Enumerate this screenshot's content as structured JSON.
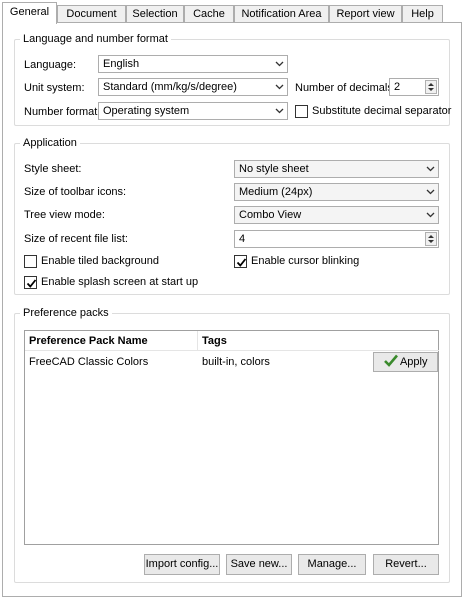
{
  "tabs": [
    {
      "label": "General"
    },
    {
      "label": "Document"
    },
    {
      "label": "Selection"
    },
    {
      "label": "Cache"
    },
    {
      "label": "Notification Area"
    },
    {
      "label": "Report view"
    },
    {
      "label": "Help"
    }
  ],
  "language_group": {
    "title": "Language and number format",
    "language_label": "Language:",
    "language_value": "English",
    "unit_label": "Unit system:",
    "unit_value": "Standard (mm/kg/s/degree)",
    "decimals_label": "Number of decimals:",
    "decimals_value": "2",
    "number_format_label": "Number format:",
    "number_format_value": "Operating system",
    "substitute_label": "Substitute decimal separator",
    "substitute_checked": false
  },
  "application_group": {
    "title": "Application",
    "style_label": "Style sheet:",
    "style_value": "No style sheet",
    "toolbar_label": "Size of toolbar icons:",
    "toolbar_value": "Medium (24px)",
    "tree_label": "Tree view mode:",
    "tree_value": "Combo View",
    "recent_label": "Size of recent file list:",
    "recent_value": "4",
    "tiled_label": "Enable tiled background",
    "tiled_checked": false,
    "cursor_label": "Enable cursor blinking",
    "cursor_checked": true,
    "splash_label": "Enable splash screen at start up",
    "splash_checked": true
  },
  "prefs_group": {
    "title": "Preference packs",
    "col_name": "Preference Pack Name",
    "col_tags": "Tags",
    "rows": [
      {
        "name": "FreeCAD Classic Colors",
        "tags": "built-in, colors",
        "action": "Apply"
      }
    ],
    "import_label": "Import config...",
    "save_label": "Save new...",
    "manage_label": "Manage...",
    "revert_label": "Revert..."
  }
}
